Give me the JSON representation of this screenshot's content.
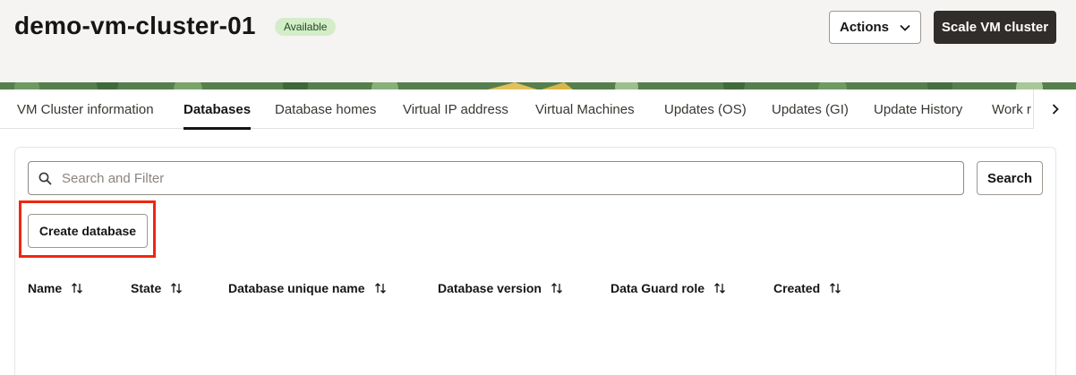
{
  "header": {
    "title": "demo-vm-cluster-01",
    "status": "Available",
    "actions_label": "Actions",
    "scale_label": "Scale VM cluster",
    "status_color": "#d4edc9"
  },
  "tabs": [
    {
      "label": "VM Cluster information",
      "active": false
    },
    {
      "label": "Databases",
      "active": true
    },
    {
      "label": "Database homes",
      "active": false
    },
    {
      "label": "Virtual IP address",
      "active": false
    },
    {
      "label": "Virtual Machines",
      "active": false
    },
    {
      "label": "Updates (OS)",
      "active": false
    },
    {
      "label": "Updates (GI)",
      "active": false
    },
    {
      "label": "Update History",
      "active": false
    },
    {
      "label": "Work r",
      "active": false
    }
  ],
  "search": {
    "placeholder": "Search and Filter",
    "value": "",
    "button_label": "Search"
  },
  "create_label": "Create database",
  "table": {
    "columns": [
      "Name",
      "State",
      "Database unique name",
      "Database version",
      "Data Guard role",
      "Created"
    ],
    "rows": []
  },
  "colors": {
    "primary_button": "#312d2a",
    "highlight": "#f0270f"
  }
}
